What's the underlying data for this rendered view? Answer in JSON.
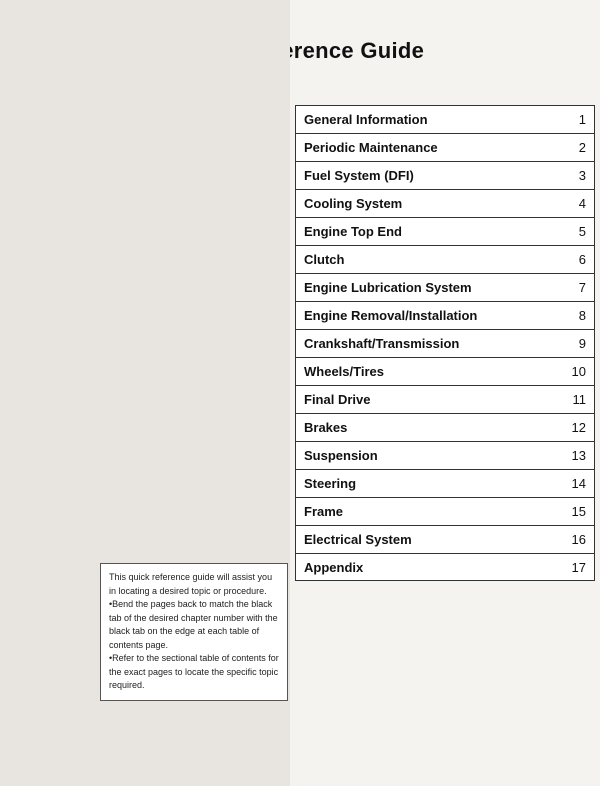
{
  "page": {
    "title": "Quick Reference Guide",
    "toc": {
      "items": [
        {
          "label": "General Information",
          "number": "1"
        },
        {
          "label": "Periodic Maintenance",
          "number": "2"
        },
        {
          "label": "Fuel System (DFI)",
          "number": "3"
        },
        {
          "label": "Cooling System",
          "number": "4"
        },
        {
          "label": "Engine Top End",
          "number": "5"
        },
        {
          "label": "Clutch",
          "number": "6"
        },
        {
          "label": "Engine Lubrication System",
          "number": "7"
        },
        {
          "label": "Engine Removal/Installation",
          "number": "8"
        },
        {
          "label": "Crankshaft/Transmission",
          "number": "9"
        },
        {
          "label": "Wheels/Tires",
          "number": "10"
        },
        {
          "label": "Final Drive",
          "number": "11"
        },
        {
          "label": "Brakes",
          "number": "12"
        },
        {
          "label": "Suspension",
          "number": "13"
        },
        {
          "label": "Steering",
          "number": "14"
        },
        {
          "label": "Frame",
          "number": "15"
        },
        {
          "label": "Electrical System",
          "number": "16"
        },
        {
          "label": "Appendix",
          "number": "17"
        }
      ]
    },
    "note": {
      "text": "This quick reference guide will assist you in locating a desired topic or procedure.\n•Bend the pages back to match the black tab of the desired chapter number with the black tab on the edge at each table of contents page.\n•Refer to the sectional table of contents for the exact pages to locate the specific topic required."
    }
  }
}
